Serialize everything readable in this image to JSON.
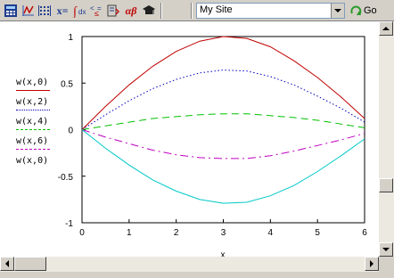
{
  "toolbar": {
    "items": [
      {
        "name": "calculator-icon"
      },
      {
        "name": "graph-icon"
      },
      {
        "name": "matrix-icon"
      },
      {
        "name": "evaluation-icon",
        "text": "x="
      },
      {
        "name": "calculus-icon"
      },
      {
        "name": "boolean-icon"
      },
      {
        "name": "programming-icon"
      },
      {
        "name": "greek-icon",
        "text": "αβ"
      },
      {
        "name": "symbolic-icon"
      }
    ],
    "site_value": "My Site",
    "go_label": "Go"
  },
  "chart_data": {
    "type": "line",
    "xlabel": "x",
    "xlim": [
      0,
      6
    ],
    "ylim": [
      -1,
      1
    ],
    "xticks": [
      "0",
      "1",
      "2",
      "3",
      "4",
      "5",
      "6"
    ],
    "yticks": [
      "1",
      "0.5",
      "0",
      "-0.5",
      "-1"
    ],
    "series": [
      {
        "name": "w(x,0)",
        "color": "#c00000",
        "style": "solid",
        "x": [
          0,
          0.5,
          1,
          1.5,
          2,
          2.5,
          3,
          3.5,
          4,
          4.5,
          5,
          5.5,
          6
        ],
        "values": [
          0,
          0.25,
          0.48,
          0.68,
          0.84,
          0.95,
          1.0,
          0.98,
          0.89,
          0.74,
          0.56,
          0.35,
          0.12
        ]
      },
      {
        "name": "w(x,2)",
        "color": "#0000c0",
        "style": "dotted",
        "x": [
          0,
          0.5,
          1,
          1.5,
          2,
          2.5,
          3,
          3.5,
          4,
          4.5,
          5,
          5.5,
          6
        ],
        "values": [
          0,
          0.16,
          0.31,
          0.44,
          0.54,
          0.61,
          0.64,
          0.63,
          0.57,
          0.48,
          0.36,
          0.23,
          0.08
        ]
      },
      {
        "name": "w(x,4)",
        "color": "#00c000",
        "style": "dashed",
        "x": [
          0,
          0.5,
          1,
          1.5,
          2,
          2.5,
          3,
          3.5,
          4,
          4.5,
          5,
          5.5,
          6
        ],
        "values": [
          0,
          0.04,
          0.08,
          0.12,
          0.14,
          0.16,
          0.17,
          0.17,
          0.15,
          0.13,
          0.1,
          0.06,
          0.02
        ]
      },
      {
        "name": "w(x,6)",
        "color": "#c000c0",
        "style": "dashdot",
        "x": [
          0,
          0.5,
          1,
          1.5,
          2,
          2.5,
          3,
          3.5,
          4,
          4.5,
          5,
          5.5,
          6
        ],
        "values": [
          0,
          -0.08,
          -0.15,
          -0.22,
          -0.27,
          -0.3,
          -0.31,
          -0.31,
          -0.28,
          -0.23,
          -0.17,
          -0.11,
          -0.04
        ]
      },
      {
        "name": "w(x,0)",
        "color": "#00c8c8",
        "style": "solid",
        "x": [
          0,
          0.5,
          1,
          1.5,
          2,
          2.5,
          3,
          3.5,
          4,
          4.5,
          5,
          5.5,
          6
        ],
        "values": [
          0,
          -0.2,
          -0.38,
          -0.54,
          -0.66,
          -0.75,
          -0.79,
          -0.78,
          -0.71,
          -0.6,
          -0.45,
          -0.28,
          -0.1
        ]
      }
    ]
  },
  "legend": [
    {
      "label": "w(x,0)"
    },
    {
      "label": "w(x,2)"
    },
    {
      "label": "w(x,4)"
    },
    {
      "label": "w(x,6)"
    },
    {
      "label": "w(x,0)"
    }
  ]
}
